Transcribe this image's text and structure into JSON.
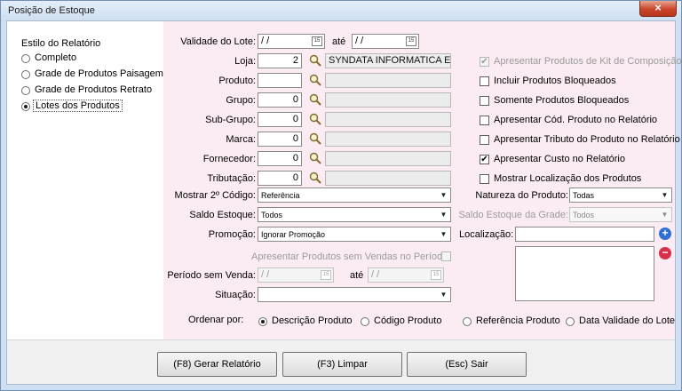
{
  "window": {
    "title": "Posição de Estoque",
    "close_glyph": "×"
  },
  "report_style": {
    "heading": "Estilo do Relatório",
    "options": [
      {
        "label": "Completo",
        "selected": false
      },
      {
        "label": "Grade de Produtos Paisagem",
        "selected": false
      },
      {
        "label": "Grade de Produtos Retrato",
        "selected": false
      },
      {
        "label": "Lotes dos Produtos",
        "selected": true
      }
    ]
  },
  "form": {
    "validade_label": "Validade do Lote:",
    "validade_from": "/  /",
    "ate_label": "até",
    "validade_to": "/  /",
    "calendar_glyph": "15",
    "loja_label": "Loja:",
    "loja_code": "2",
    "loja_name": "SYNDATA INFORMATICA E AU",
    "produto_label": "Produto:",
    "produto_code": "",
    "produto_name": "",
    "grupo_label": "Grupo:",
    "grupo_code": "0",
    "subgrupo_label": "Sub-Grupo:",
    "subgrupo_code": "0",
    "marca_label": "Marca:",
    "marca_code": "0",
    "fornecedor_label": "Fornecedor:",
    "fornecedor_code": "0",
    "tributacao_label": "Tributação:",
    "tributacao_code": "0",
    "mostrar_codigo_label": "Mostrar 2º Código:",
    "mostrar_codigo_value": "Referência",
    "saldo_estoque_label": "Saldo Estoque:",
    "saldo_estoque_value": "Todos",
    "promocao_label": "Promoção:",
    "promocao_value": "Ignorar Promoção",
    "sem_vendas_label": "Apresentar Produtos sem Vendas no Período",
    "periodo_label": "Período sem Venda:",
    "periodo_from": "/  /",
    "periodo_ate_label": "até",
    "periodo_to": "/  /",
    "situacao_label": "Situação:",
    "situacao_value": ""
  },
  "options": [
    {
      "label": "Apresentar Produtos de Kit de Composição",
      "checked": true,
      "disabled": true
    },
    {
      "label": "Incluir Produtos Bloqueados",
      "checked": false,
      "disabled": false
    },
    {
      "label": "Somente Produtos Bloqueados",
      "checked": false,
      "disabled": false
    },
    {
      "label": "Apresentar Cód. Produto no Relatório",
      "checked": false,
      "disabled": false
    },
    {
      "label": "Apresentar Tributo do Produto no Relatório",
      "checked": false,
      "disabled": false
    },
    {
      "label": "Apresentar Custo no Relatório",
      "checked": true,
      "disabled": false
    },
    {
      "label": "Mostrar Localização dos Produtos",
      "checked": false,
      "disabled": false
    }
  ],
  "natureza": {
    "label": "Natureza do Produto:",
    "value": "Todas"
  },
  "saldo_grade": {
    "label": "Saldo Estoque da Grade:",
    "value": "Todos"
  },
  "localizacao": {
    "label": "Localização:",
    "value": "",
    "add_glyph": "+",
    "remove_glyph": "−"
  },
  "ordenar": {
    "label": "Ordenar por:",
    "options": [
      {
        "label": "Descrição Produto",
        "selected": true
      },
      {
        "label": "Código Produto",
        "selected": false
      },
      {
        "label": "Referência Produto",
        "selected": false
      },
      {
        "label": "Data Validade do Lote",
        "selected": false
      }
    ]
  },
  "buttons": {
    "gerar": "(F8) Gerar Relatório",
    "limpar": "(F3) Limpar",
    "sair": "(Esc) Sair"
  },
  "colors": {
    "add": "#2f6fd6",
    "remove": "#d9304a",
    "panel": "#fbecf3"
  }
}
